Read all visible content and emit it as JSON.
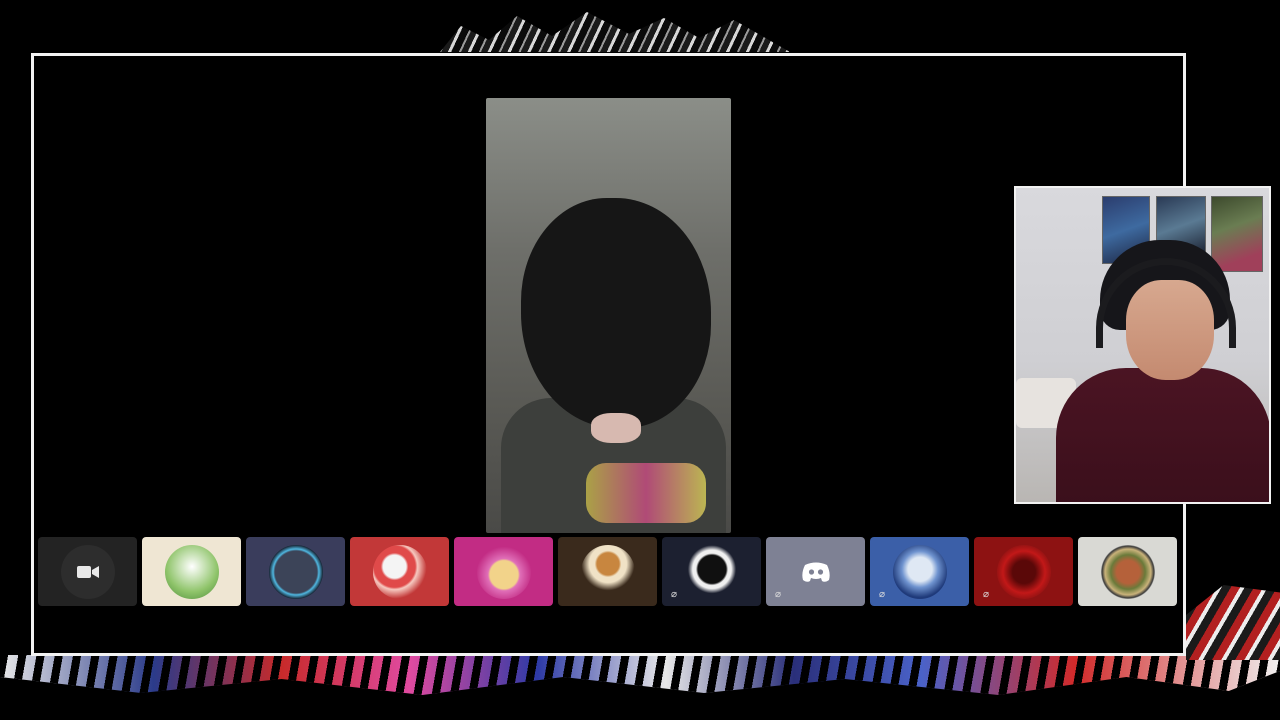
{
  "participants": [
    {
      "id": "p1",
      "bg": "#232323",
      "avatar": "camera-icon",
      "muted": false
    },
    {
      "id": "p2",
      "bg": "#efe6d3",
      "avatar": "cartoon-character-avatar",
      "muted": false
    },
    {
      "id": "p3",
      "bg": "#3a3d5c",
      "avatar": "portrait-ring-avatar",
      "muted": false
    },
    {
      "id": "p4",
      "bg": "#c23838",
      "avatar": "candy-characters-avatar",
      "muted": false
    },
    {
      "id": "p5",
      "bg": "#c22c84",
      "avatar": "pink-cat-avatar",
      "muted": false
    },
    {
      "id": "p6",
      "bg": "#3a2a1c",
      "avatar": "cartoon-sign-avatar",
      "muted": false
    },
    {
      "id": "p7",
      "bg": "#1c2030",
      "avatar": "dark-figure-avatar",
      "muted": true
    },
    {
      "id": "p8",
      "bg": "#7e8194",
      "avatar": "discord-logo-avatar",
      "muted": true
    },
    {
      "id": "p9",
      "bg": "#3b5fa8",
      "avatar": "blue-anime-avatar",
      "muted": true
    },
    {
      "id": "p10",
      "bg": "#8d1212",
      "avatar": "red-creature-avatar",
      "muted": true
    },
    {
      "id": "p11",
      "bg": "#d9d9d4",
      "avatar": "blocky-character-avatar",
      "muted": false
    }
  ],
  "icons": {
    "mute": "mic-muted-icon",
    "camera": "camera-icon"
  }
}
